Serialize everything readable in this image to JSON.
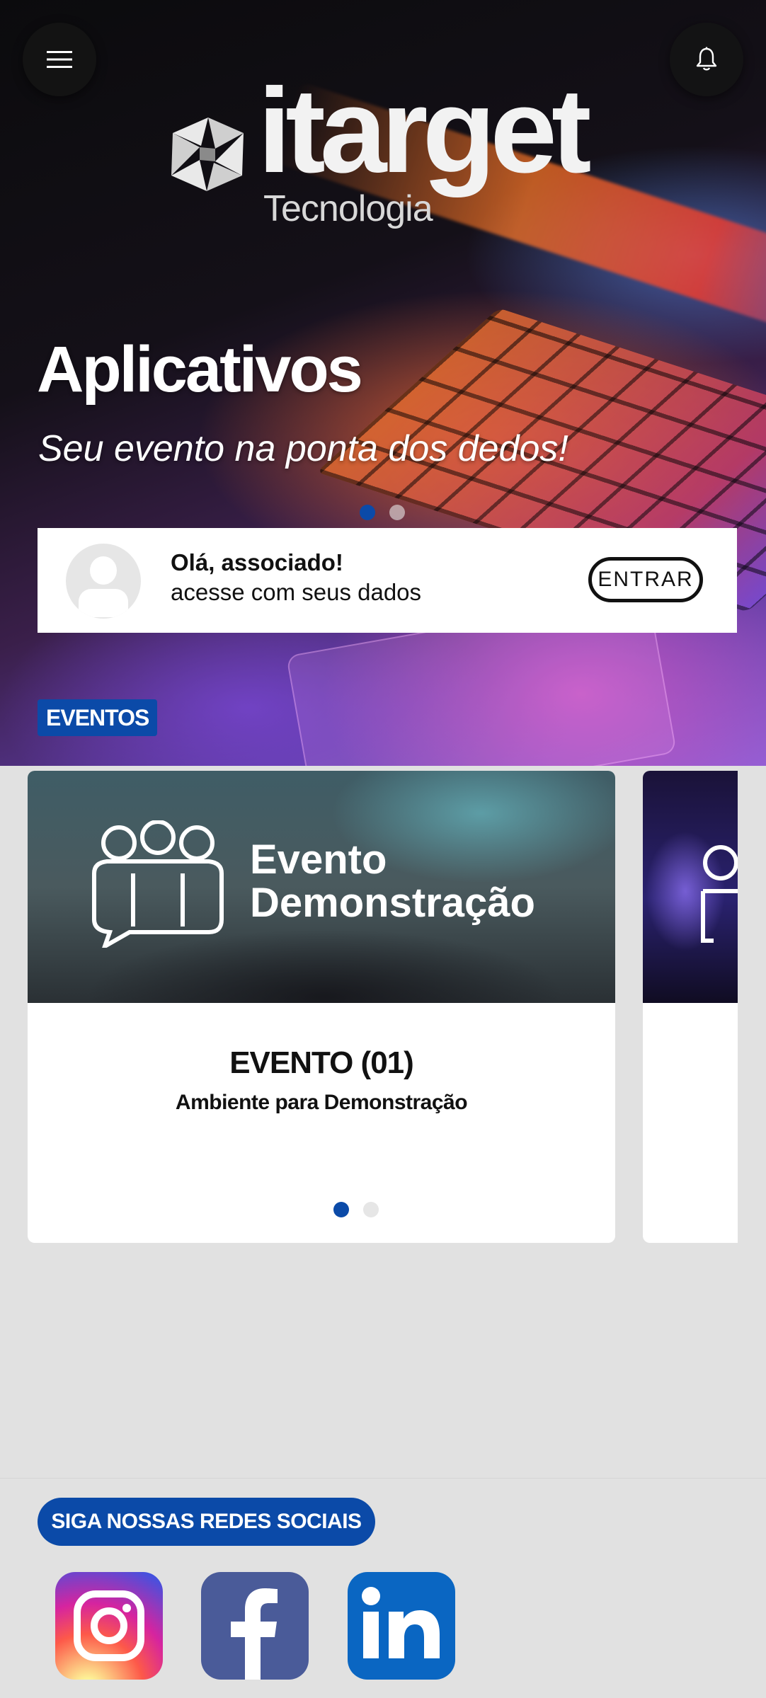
{
  "header": {
    "menu_icon": "hamburger-menu-icon",
    "notification_icon": "bell-icon"
  },
  "logo": {
    "word": "itarget",
    "sub": "Tecnologia"
  },
  "banner": {
    "title": "Aplicativos",
    "subtitle": "Seu evento na ponta dos dedos!",
    "slides": 2,
    "active_slide": 1
  },
  "login": {
    "greeting": "Olá, associado!",
    "prompt": "acesse com seus dados",
    "button": "ENTRAR"
  },
  "events": {
    "section_label": "EVENTOS",
    "items": [
      {
        "image_text_line1": "Evento",
        "image_text_line2": "Demonstração",
        "name": "EVENTO (01)",
        "description": "Ambiente para Demonstração"
      }
    ],
    "slides": 2,
    "active_slide": 1
  },
  "social": {
    "label": "SIGA NOSSAS REDES SOCIAIS",
    "networks": [
      "instagram-icon",
      "facebook-icon",
      "linkedin-icon"
    ]
  },
  "colors": {
    "accent": "#0b4aa8",
    "background": "#e1e1e1"
  }
}
